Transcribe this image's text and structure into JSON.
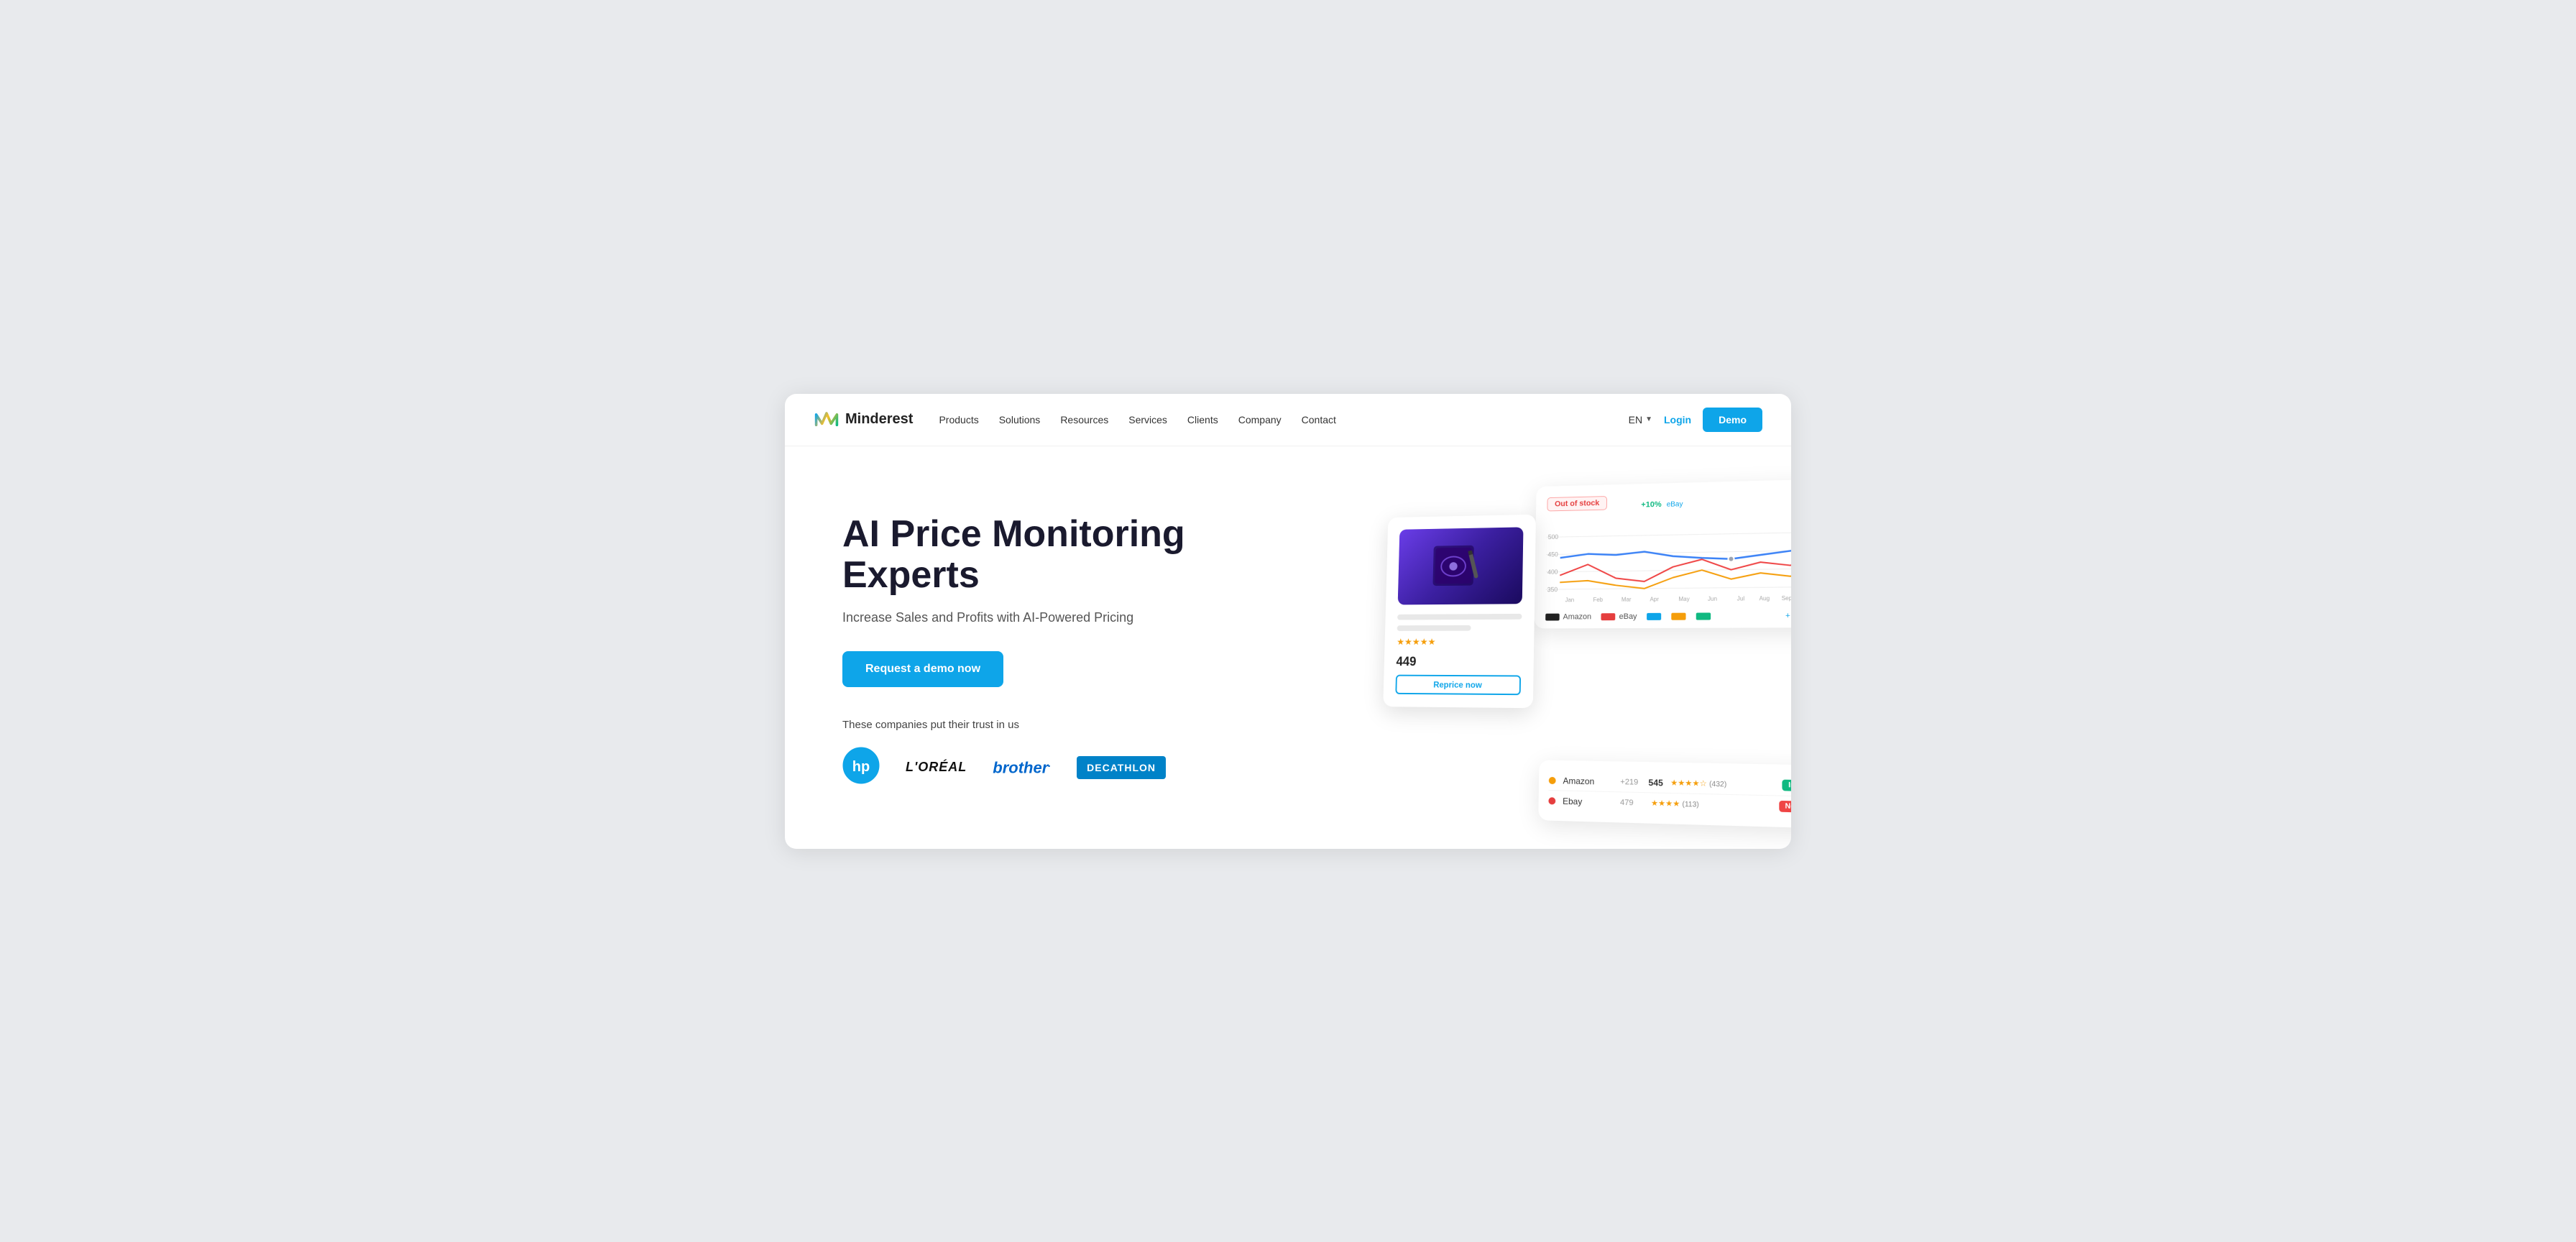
{
  "nav": {
    "logo_text": "Minderest",
    "links": [
      {
        "label": "Products",
        "id": "products"
      },
      {
        "label": "Solutions",
        "id": "solutions"
      },
      {
        "label": "Resources",
        "id": "resources"
      },
      {
        "label": "Services",
        "id": "services"
      },
      {
        "label": "Clients",
        "id": "clients"
      },
      {
        "label": "Company",
        "id": "company"
      },
      {
        "label": "Contact",
        "id": "contact"
      }
    ],
    "lang": "EN",
    "login_label": "Login",
    "demo_label": "Demo"
  },
  "hero": {
    "title_line1": "AI Price Monitoring",
    "title_line2": "Experts",
    "subtitle": "Increase Sales and Profits with AI-Powered Pricing",
    "cta_label": "Request a demo now",
    "trust_text": "These companies put their trust in us",
    "brands": [
      "HP",
      "L'ORÉAL",
      "brother.",
      "DECATHLON"
    ]
  },
  "product_card": {
    "price": "449",
    "stars": "★★★★★",
    "reprice_btn": "Reprice now"
  },
  "chart": {
    "out_of_stock": "Out of stock",
    "badge_green": "+10%",
    "add_more": "+ Add more"
  },
  "table": {
    "rows": [
      {
        "name": "Amazon",
        "price_old": "219",
        "price": "545",
        "stars": "★★★★☆",
        "reviews": "(432)",
        "stock": "In stock",
        "stock_color": "green"
      },
      {
        "name": "Ebay",
        "price_old": "479",
        "price": "",
        "stars": "★★★★",
        "reviews": "(113)",
        "stock": "No stock",
        "stock_color": "red"
      }
    ]
  }
}
